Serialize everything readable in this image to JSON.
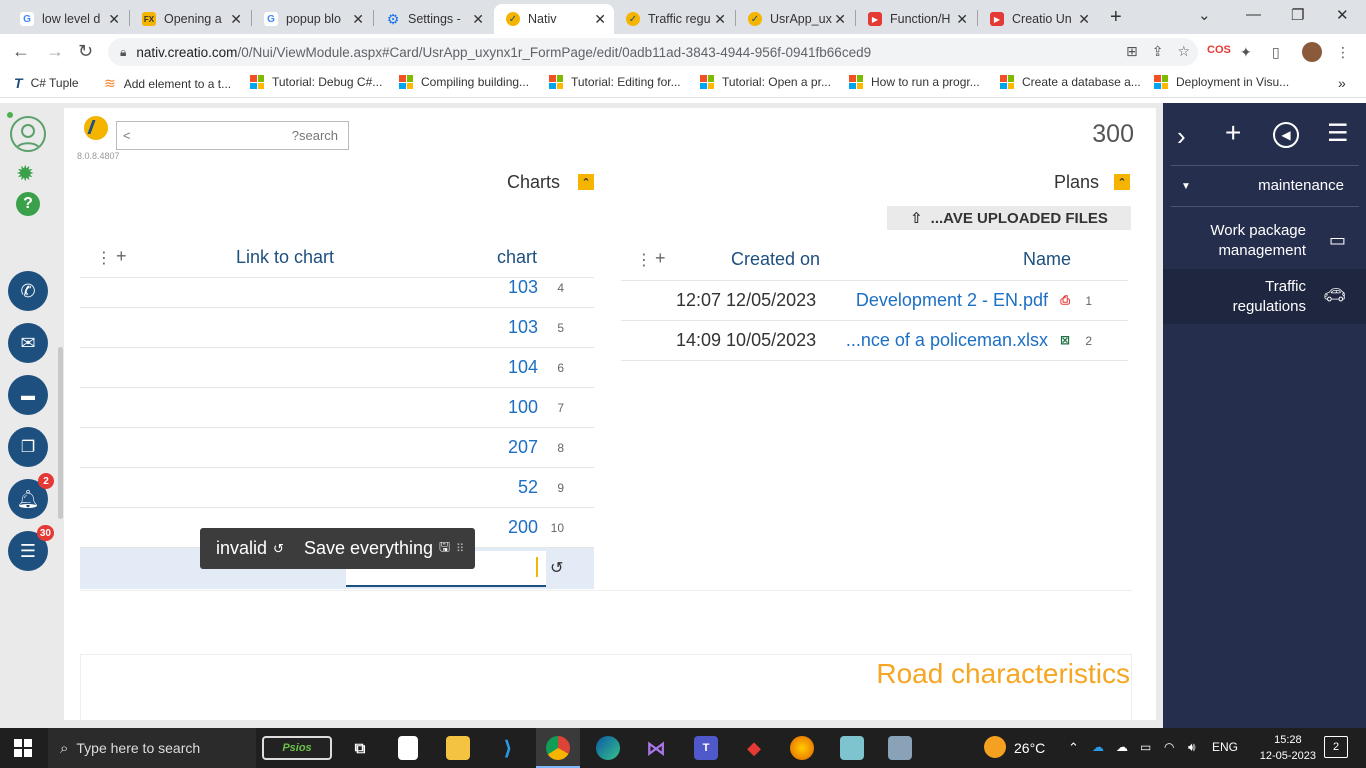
{
  "browser": {
    "tabs": [
      {
        "title": "low level d",
        "fav": "G",
        "fav_color": "#4285f4"
      },
      {
        "title": "Opening a",
        "fav": "FX",
        "fav_color": "#f4b400"
      },
      {
        "title": "popup blo",
        "fav": "G",
        "fav_color": "#4285f4"
      },
      {
        "title": "Settings - ",
        "fav": "⚙",
        "fav_color": "#1a73e8"
      },
      {
        "title": "Nativ",
        "fav": "✓",
        "fav_color": "#f4b400"
      },
      {
        "title": "Traffic regu",
        "fav": "✓",
        "fav_color": "#f4b400"
      },
      {
        "title": "UsrApp_ux",
        "fav": "✓",
        "fav_color": "#f4b400"
      },
      {
        "title": "Function/H",
        "fav": "▶",
        "fav_color": "#e53935"
      },
      {
        "title": "Creatio Un",
        "fav": "▶",
        "fav_color": "#e53935"
      }
    ],
    "url_host": "nativ.creatio.com",
    "url_path": "/0/Nui/ViewModule.aspx#Card/UsrApp_uxynx1r_FormPage/edit/0adb11ad-3843-4944-956f-0941fb66ced9",
    "bookmarks": [
      "C# Tuple",
      "Add element to a t...",
      "Tutorial: Debug C#...",
      "Compiling building...",
      "Tutorial: Editing for...",
      "Tutorial: Open a pr...",
      "How to run a progr...",
      "Create a database a...",
      "Deployment in Visu..."
    ],
    "more_bookmarks": "»"
  },
  "left_bar": {
    "notifications_badge": "2",
    "feed_badge": "30"
  },
  "header": {
    "version": "8.0.8.4807",
    "search_back": "<",
    "search_placeholder": "?search",
    "counter": "300"
  },
  "charts": {
    "title": "Charts",
    "col_link": "Link to chart",
    "col_chart": "chart",
    "rows": [
      {
        "value": "103",
        "num": "4"
      },
      {
        "value": "103",
        "num": "5"
      },
      {
        "value": "104",
        "num": "6"
      },
      {
        "value": "100",
        "num": "7"
      },
      {
        "value": "207",
        "num": "8"
      },
      {
        "value": "52",
        "num": "9"
      },
      {
        "value": "200",
        "num": "10"
      }
    ]
  },
  "popup": {
    "invalid_label": "invalid",
    "save_label": "Save everything"
  },
  "plans": {
    "title": "Plans",
    "upload_label": "...AVE UPLOADED FILES",
    "col_created": "Created on",
    "col_name": "Name",
    "rows": [
      {
        "date": "12:07 12/05/2023",
        "name": "Development 2 - EN.pdf",
        "num": "1",
        "icon": "pdf-icon"
      },
      {
        "date": "14:09 10/05/2023",
        "name": "...nce of a policeman.xlsx",
        "num": "2",
        "icon": "excel-icon"
      }
    ]
  },
  "road": {
    "title": "Road characteristics"
  },
  "right_panel": {
    "group": "maintenance",
    "items": [
      {
        "label_line1": "Work package",
        "label_line2": "management"
      },
      {
        "label_line1": "Traffic",
        "label_line2": "regulations"
      }
    ]
  },
  "taskbar": {
    "search_placeholder": "Type here to search",
    "weather": "26°C",
    "lang": "ENG",
    "time": "15:28",
    "date": "12-05-2023",
    "notif_count": "2"
  },
  "colors": {
    "accent": "#f4b400",
    "link": "#1d6fc4",
    "nav_blue": "#1d4f7f",
    "panel_dark": "#252e4c",
    "road_orange": "#f5a623"
  }
}
